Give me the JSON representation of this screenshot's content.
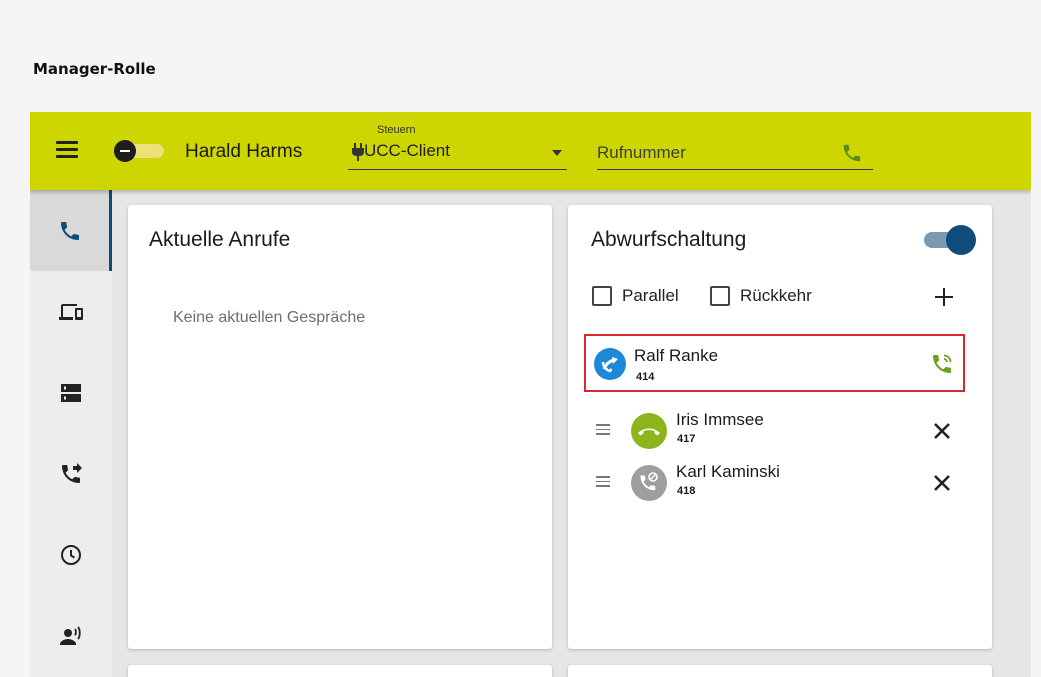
{
  "page": {
    "heading": "Manager-Rolle"
  },
  "header": {
    "menu_icon": "hamburger-menu-icon",
    "presence_icon": "do-not-disturb-icon",
    "user_name": "Harald Harms",
    "control": {
      "label": "Steuern",
      "icon": "plug-icon",
      "value": "UCC-Client"
    },
    "dial": {
      "placeholder": "Rufnummer",
      "icon": "phone-icon"
    }
  },
  "sidebar": {
    "items": [
      {
        "icon": "phone-icon",
        "active": true
      },
      {
        "icon": "devices-icon",
        "active": false
      },
      {
        "icon": "server-icon",
        "active": false
      },
      {
        "icon": "call-forward-icon",
        "active": false
      },
      {
        "icon": "clock-icon",
        "active": false
      },
      {
        "icon": "voice-person-icon",
        "active": false
      }
    ]
  },
  "current_calls": {
    "title": "Aktuelle Anrufe",
    "empty_text": "Keine aktuellen Gespräche"
  },
  "forwarding": {
    "title": "Abwurfschaltung",
    "enabled": true,
    "options": {
      "parallel_label": "Parallel",
      "return_label": "Rückkehr"
    },
    "target": {
      "name": "Ralf Ranke",
      "ext": "414",
      "status_icon": "call-forward-avatar-icon",
      "action_icon": "phone-ringing-icon"
    },
    "members": [
      {
        "name": "Iris Immsee",
        "ext": "417",
        "status_icon": "hangup-icon",
        "status_color": "#8cb51c"
      },
      {
        "name": "Karl Kaminski",
        "ext": "418",
        "status_icon": "phone-disabled-icon",
        "status_color": "#9e9e9e"
      }
    ]
  },
  "colors": {
    "topbar": "#cdd600",
    "accent": "#0f4c7a",
    "highlight_border": "#d9272e",
    "target_avatar": "#1d88d8",
    "phone_green": "#6fa01f"
  }
}
